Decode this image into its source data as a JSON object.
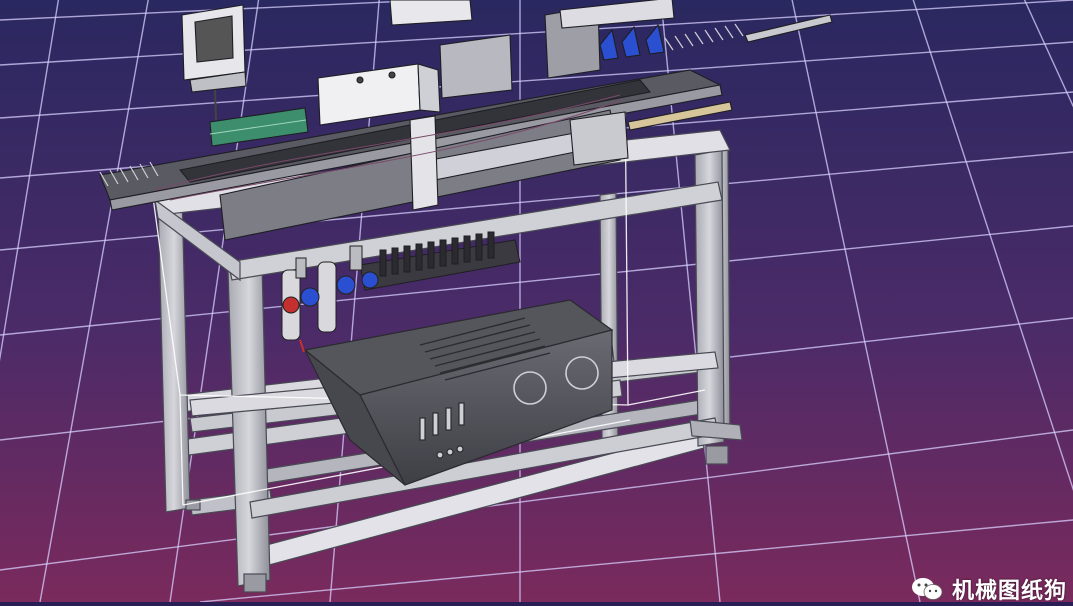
{
  "viewport": {
    "background_top": "#2a2860",
    "background_bottom": "#7a2a5c",
    "grid_color": "#d8d0ff",
    "frame_color": "#e9e9ee",
    "frame_edge": "#5a5a66",
    "machine_dark": "#3c3c42",
    "machine_mid": "#8c8c94",
    "accent_blue": "#2a4fd0",
    "accent_green": "#3c8e6c",
    "accent_red": "#c43030",
    "accent_tan": "#d6c49a"
  },
  "watermark": {
    "icon": "wechat-icon",
    "text": "机械图纸狗"
  }
}
